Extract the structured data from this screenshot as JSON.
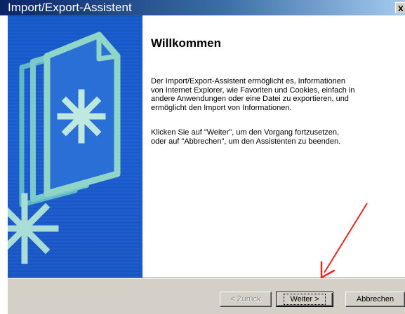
{
  "window": {
    "title": "Import/Export-Assistent",
    "close_label": "x",
    "title_bar_color": "#0a246a"
  },
  "side_panel": {
    "background_color": "#1f64d8",
    "icons": [
      "documents-icon",
      "asterisk-icon"
    ]
  },
  "main": {
    "heading": "Willkommen",
    "paragraph1": "Der Import/Export-Assistent ermöglicht es, Informationen\nvon Internet Explorer, wie Favoriten und Cookies, einfach in\nandere Anwendungen oder eine Datei zu exportieren, und\nermöglicht den Import von Informationen.",
    "paragraph2": "Klicken Sie auf \"Weiter\", um den Vorgang fortzusetzen,\noder auf \"Abbrechen\", um den Assistenten zu beenden."
  },
  "buttons": {
    "back": "< Zurück",
    "next": "Weiter >",
    "cancel": "Abbrechen"
  },
  "annotation": {
    "arrow_color": "#e8281c",
    "points_to": "Weiter >"
  }
}
